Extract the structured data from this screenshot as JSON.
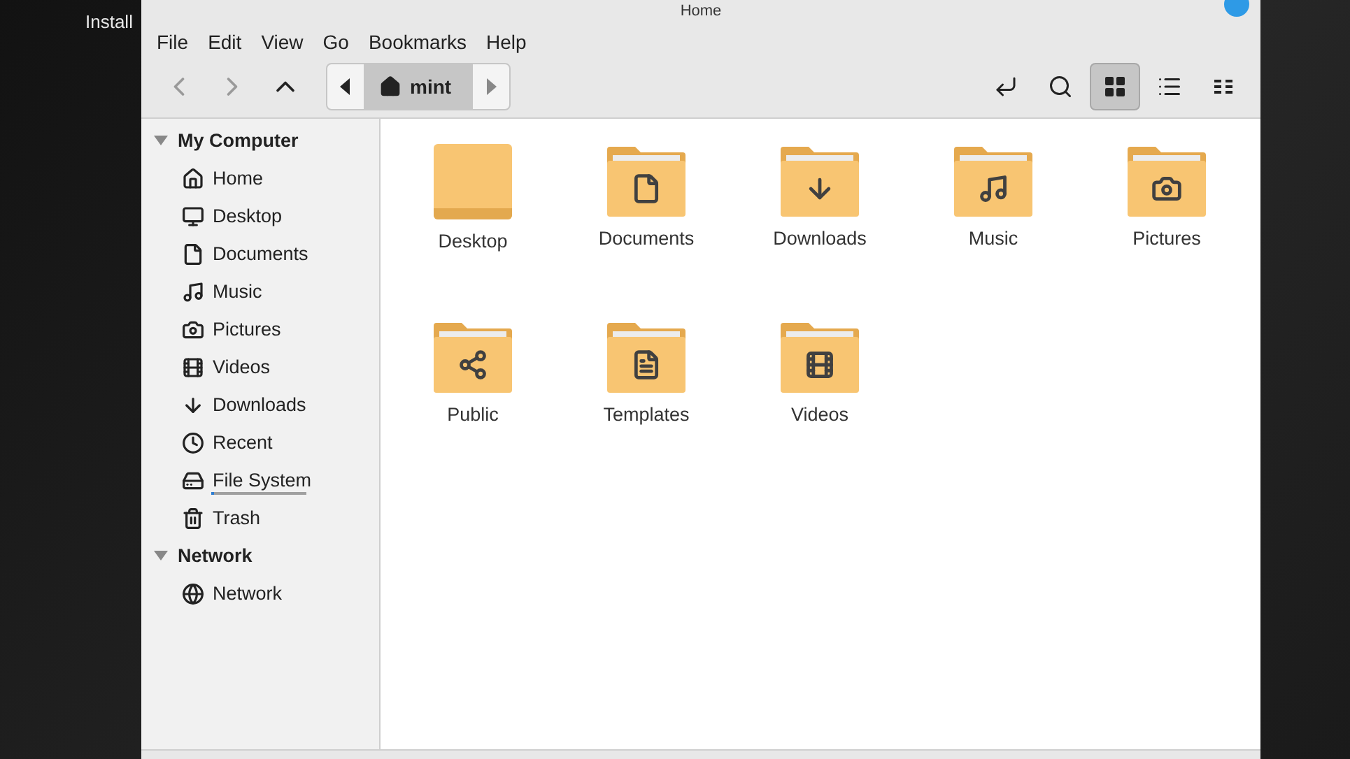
{
  "desktop": {
    "label": "Install"
  },
  "window": {
    "title": "Home"
  },
  "menu": [
    "File",
    "Edit",
    "View",
    "Go",
    "Bookmarks",
    "Help"
  ],
  "navigation": [
    {
      "kind": "back",
      "disabled": true
    },
    {
      "kind": "forward",
      "disabled": true
    },
    {
      "kind": "up",
      "disabled": false
    }
  ],
  "path_bar": {
    "segments": [
      {
        "label": "mint",
        "selected": true
      }
    ]
  },
  "view_buttons": [
    {
      "kind": "location",
      "selected": false
    },
    {
      "kind": "search",
      "selected": false
    },
    {
      "kind": "icons",
      "selected": true
    },
    {
      "kind": "list",
      "selected": false
    },
    {
      "kind": "compact",
      "selected": false
    }
  ],
  "sidebar": {
    "sections": [
      {
        "title": "My Computer",
        "expanded": true,
        "items": [
          {
            "kind": "home",
            "label": "Home"
          },
          {
            "kind": "desktop",
            "label": "Desktop"
          },
          {
            "kind": "documents",
            "label": "Documents"
          },
          {
            "kind": "music",
            "label": "Music"
          },
          {
            "kind": "pictures",
            "label": "Pictures"
          },
          {
            "kind": "videos",
            "label": "Videos"
          },
          {
            "kind": "downloads",
            "label": "Downloads"
          },
          {
            "kind": "recent",
            "label": "Recent"
          },
          {
            "kind": "filesystem",
            "label": "File System",
            "level": 0.03
          },
          {
            "kind": "trash",
            "label": "Trash"
          }
        ]
      },
      {
        "title": "Network",
        "expanded": true,
        "items": [
          {
            "kind": "network",
            "label": "Network"
          }
        ]
      }
    ]
  },
  "files": [
    {
      "kind": "desktop",
      "name": "Desktop"
    },
    {
      "kind": "documents",
      "name": "Documents"
    },
    {
      "kind": "downloads",
      "name": "Downloads"
    },
    {
      "kind": "music",
      "name": "Music"
    },
    {
      "kind": "pictures",
      "name": "Pictures"
    },
    {
      "kind": "public",
      "name": "Public"
    },
    {
      "kind": "templates",
      "name": "Templates"
    },
    {
      "kind": "videos",
      "name": "Videos"
    }
  ]
}
